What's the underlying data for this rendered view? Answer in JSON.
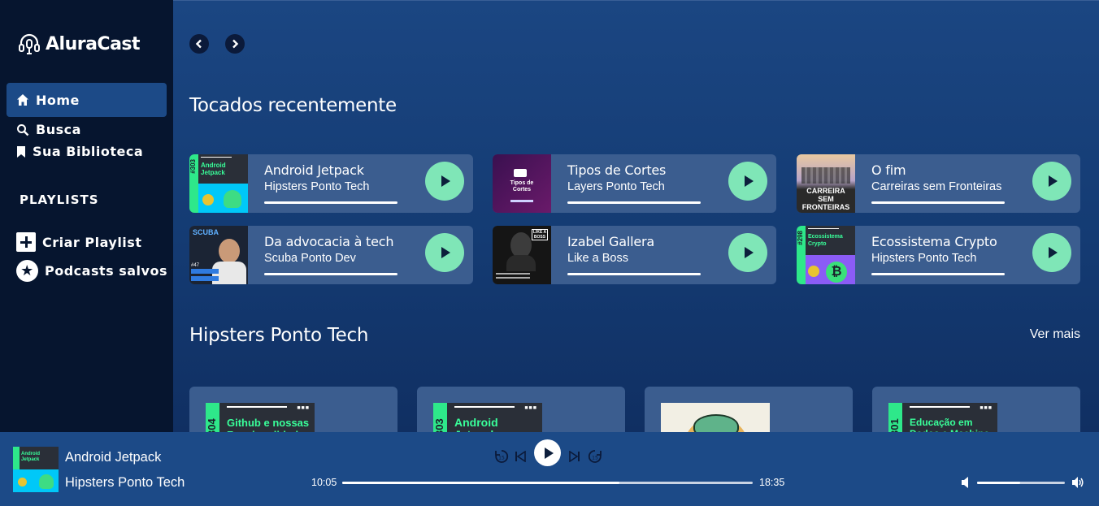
{
  "app": {
    "logo_text": "AluraCast"
  },
  "sidebar": {
    "home": "Home",
    "search": "Busca",
    "library": "Sua Biblioteca",
    "playlists_title": "PLAYLISTS",
    "create_playlist": "Criar Playlist",
    "saved_podcasts": "Podcasts salvos"
  },
  "main": {
    "recent_title": "Tocados recentemente",
    "recent": [
      {
        "title": "Android Jetpack",
        "subtitle": "Hipsters Ponto Tech",
        "thumb_text": "Android Jetpack",
        "thumb_ep": "#303"
      },
      {
        "title": "Tipos de Cortes",
        "subtitle": "Layers Ponto Tech",
        "thumb_text": "Tipos de Cortes",
        "thumb_ep": ""
      },
      {
        "title": "O fim",
        "subtitle": "Carreiras sem Fronteiras",
        "thumb_text": "CARREIRA SEM FRONTEIRAS",
        "thumb_ep": ""
      },
      {
        "title": "Da advocacia à tech",
        "subtitle": "Scuba Ponto Dev",
        "thumb_text": "SCUBA",
        "thumb_ep": "#47"
      },
      {
        "title": "Izabel Gallera",
        "subtitle": "Like a Boss",
        "thumb_text": "LIKE A BOSS",
        "thumb_ep": ""
      },
      {
        "title": "Ecossistema Crypto",
        "subtitle": "Hipsters Ponto Tech",
        "thumb_text": "Ecossistema Crypto",
        "thumb_ep": "#298"
      }
    ],
    "hipsters_title": "Hipsters Ponto Tech",
    "see_more": "Ver mais",
    "hipsters_cards": [
      {
        "ep": "304",
        "title": "Github e nossas Funcionalidades"
      },
      {
        "ep": "303",
        "title": "Android Jetpack"
      },
      {
        "ep": "",
        "title": ""
      },
      {
        "ep": "301",
        "title": "Educação em Dados e Machine"
      }
    ]
  },
  "player": {
    "title": "Android Jetpack",
    "subtitle": "Hipsters Ponto Tech",
    "time_current": "10:05",
    "time_total": "18:35",
    "progress_fraction": 0.676,
    "volume_fraction": 0.49
  },
  "colors": {
    "accent_green": "#7fe6b7",
    "sidebar_bg": "#06152f",
    "main_bg": "#1b4682",
    "card_bg": "#3b5d8f",
    "player_bg": "#1c4a87"
  }
}
